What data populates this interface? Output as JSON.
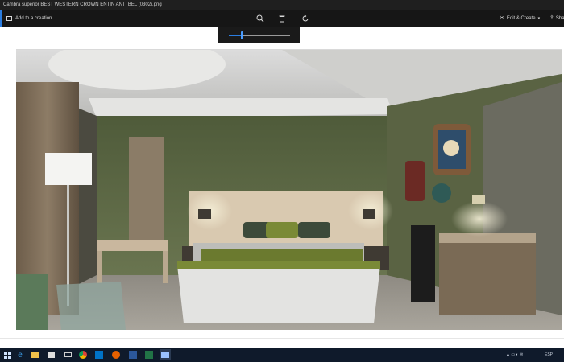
{
  "window": {
    "title": "Cambra superior BEST WESTERN CROWN ENTIN ANTI BEL (0302).png"
  },
  "toolbar": {
    "add_to_creation": "Add to a creation",
    "edit_create": "Edit & Create",
    "share": "Sha",
    "icons": [
      "zoom-icon",
      "delete-icon",
      "rotate-icon"
    ]
  },
  "zoom": {
    "level": 0.22
  },
  "image": {
    "description_icon": "bedroom-photo"
  },
  "taskbar": {
    "apps": [
      "start",
      "edge",
      "file-explorer",
      "store",
      "chrome",
      "outlook",
      "firefox",
      "excel",
      "word",
      "photos"
    ],
    "tray_lang": "ESP",
    "tray_text": "ESP"
  },
  "colors": {
    "accent": "#2b7de0",
    "wall": "#5d6a45",
    "bedspread": "#e3e3e1"
  }
}
